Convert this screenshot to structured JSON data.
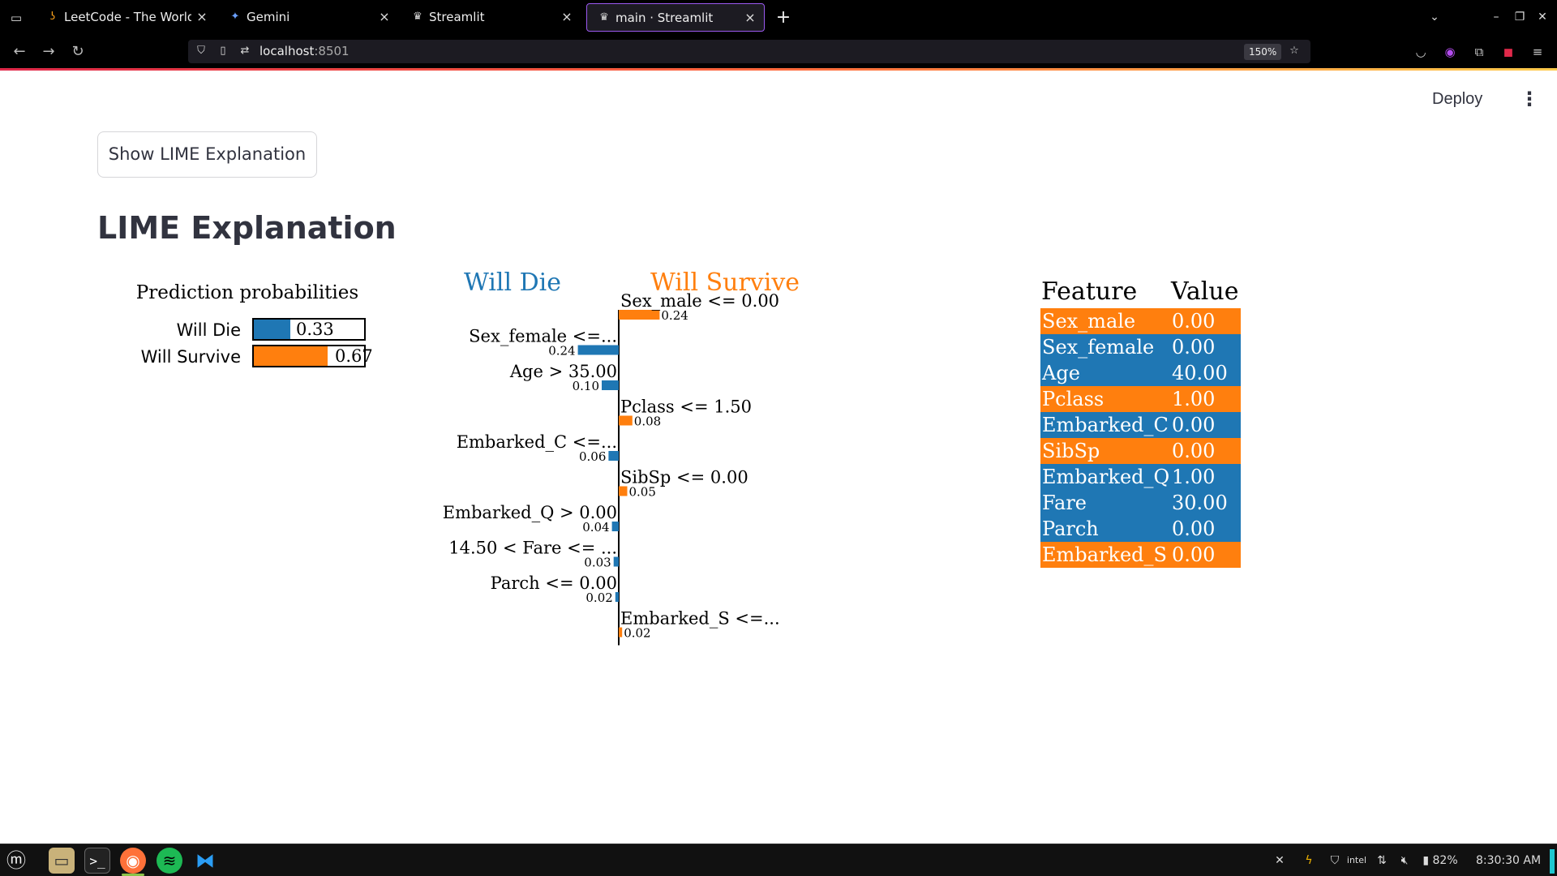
{
  "browser": {
    "tabs": [
      {
        "title": "LeetCode - The World's Leading",
        "icon": "leetcode-icon",
        "active": false
      },
      {
        "title": "Gemini",
        "icon": "gemini-icon",
        "active": false
      },
      {
        "title": "Streamlit",
        "icon": "streamlit-icon",
        "active": false
      },
      {
        "title": "main · Streamlit",
        "icon": "streamlit-icon",
        "active": true
      }
    ],
    "url_host": "localhost",
    "url_port": ":8501",
    "zoom": "150%"
  },
  "app": {
    "deploy_label": "Deploy",
    "button_label": "Show LIME Explanation",
    "title": "LIME Explanation"
  },
  "prediction": {
    "title": "Prediction probabilities",
    "rows": [
      {
        "label": "Will Die",
        "value": 0.33,
        "display": "0.33",
        "color": "#1f77b4"
      },
      {
        "label": "Will Survive",
        "value": 0.67,
        "display": "0.67",
        "color": "#ff7f0e"
      }
    ]
  },
  "chart_data": {
    "type": "bar",
    "orientation": "horizontal-diverging",
    "left_class": "Will Die",
    "right_class": "Will Survive",
    "left_color": "#1f77b4",
    "right_color": "#ff7f0e",
    "features": [
      {
        "label": "Sex_male <= 0.00",
        "weight": 0.24,
        "side": "right",
        "display": "0.24"
      },
      {
        "label": "Sex_female <=...",
        "weight": 0.24,
        "side": "left",
        "display": "0.24"
      },
      {
        "label": "Age > 35.00",
        "weight": 0.1,
        "side": "left",
        "display": "0.10"
      },
      {
        "label": "Pclass <= 1.50",
        "weight": 0.08,
        "side": "right",
        "display": "0.08"
      },
      {
        "label": "Embarked_C <=...",
        "weight": 0.06,
        "side": "left",
        "display": "0.06"
      },
      {
        "label": "SibSp <= 0.00",
        "weight": 0.05,
        "side": "right",
        "display": "0.05"
      },
      {
        "label": "Embarked_Q > 0.00",
        "weight": 0.04,
        "side": "left",
        "display": "0.04"
      },
      {
        "label": "14.50 < Fare <= ...",
        "weight": 0.03,
        "side": "left",
        "display": "0.03"
      },
      {
        "label": "Parch <= 0.00",
        "weight": 0.02,
        "side": "left",
        "display": "0.02"
      },
      {
        "label": "Embarked_S <=...",
        "weight": 0.02,
        "side": "right",
        "display": "0.02"
      }
    ]
  },
  "feature_table": {
    "header_feature": "Feature",
    "header_value": "Value",
    "rows": [
      {
        "feature": "Sex_male",
        "value": "0.00",
        "color": "#ff7f0e"
      },
      {
        "feature": "Sex_female",
        "value": "0.00",
        "color": "#1f77b4"
      },
      {
        "feature": "Age",
        "value": "40.00",
        "color": "#1f77b4"
      },
      {
        "feature": "Pclass",
        "value": "1.00",
        "color": "#ff7f0e"
      },
      {
        "feature": "Embarked_C",
        "value": "0.00",
        "color": "#1f77b4"
      },
      {
        "feature": "SibSp",
        "value": "0.00",
        "color": "#ff7f0e"
      },
      {
        "feature": "Embarked_Q",
        "value": "1.00",
        "color": "#1f77b4"
      },
      {
        "feature": "Fare",
        "value": "30.00",
        "color": "#1f77b4"
      },
      {
        "feature": "Parch",
        "value": "0.00",
        "color": "#1f77b4"
      },
      {
        "feature": "Embarked_S",
        "value": "0.00",
        "color": "#ff7f0e"
      }
    ]
  },
  "taskbar": {
    "battery": "82%",
    "clock": "8:30:30 AM",
    "apps": [
      "files-icon",
      "terminal-icon",
      "firefox-icon",
      "spotify-icon",
      "vscode-icon"
    ]
  }
}
